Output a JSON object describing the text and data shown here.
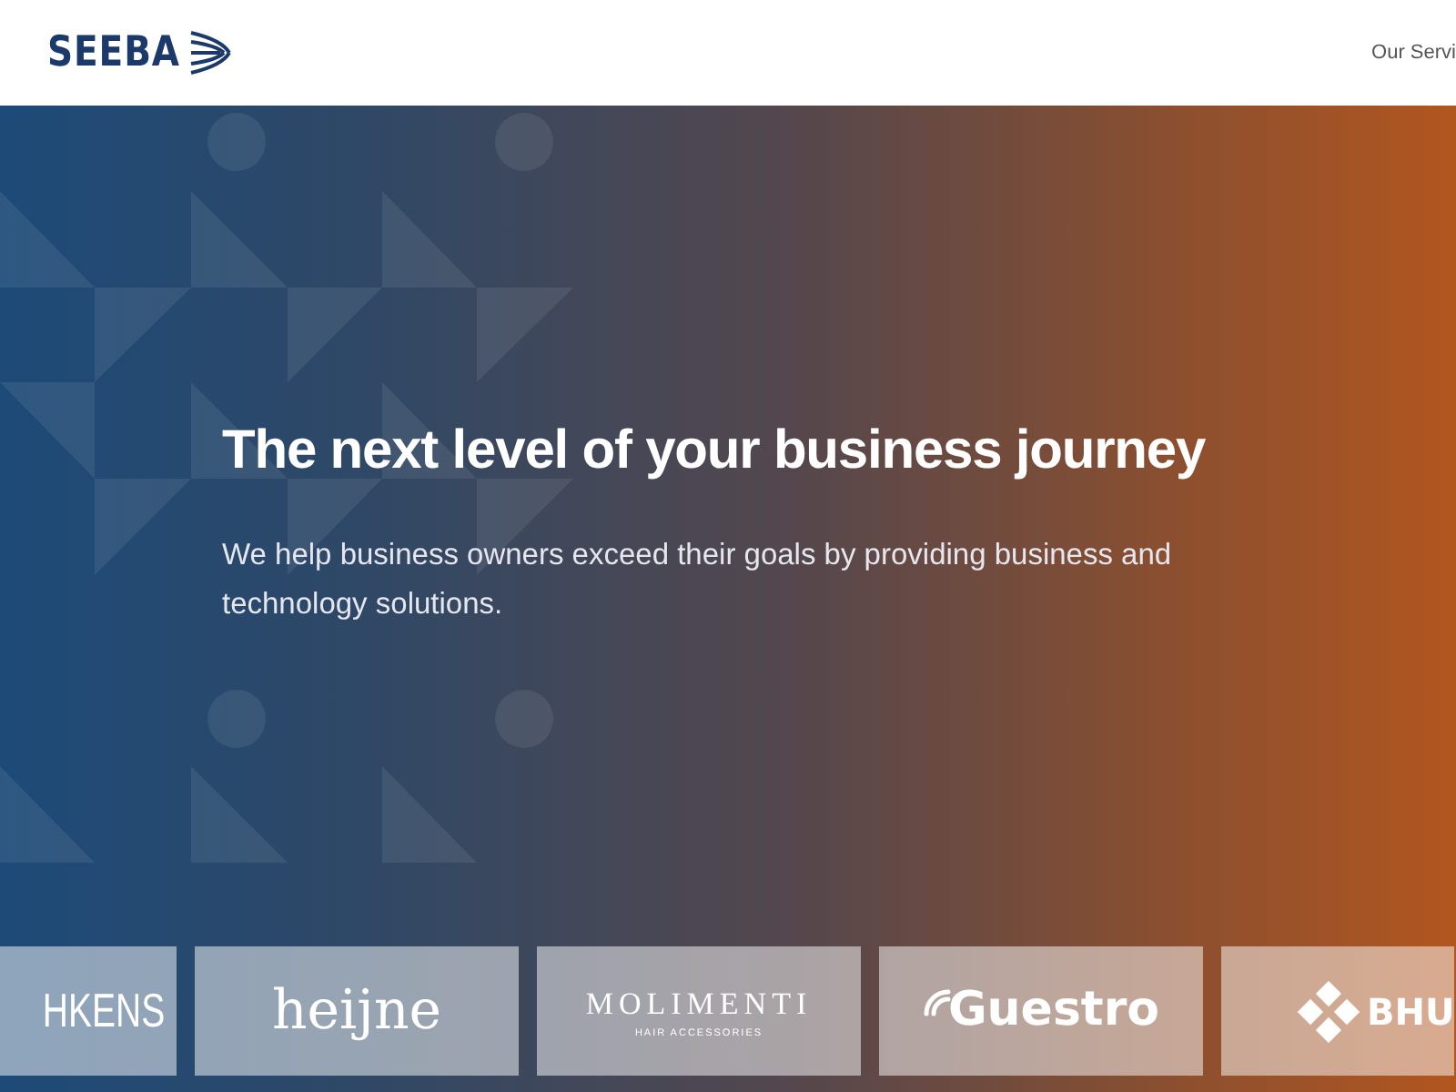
{
  "header": {
    "logo": "SEEBA",
    "nav": [
      "Our Servi"
    ]
  },
  "hero": {
    "title": "The next level of your business journey",
    "subtitle": "We help business owners exceed their goals by providing business and technology solutions."
  },
  "clients": [
    {
      "kind": "wordmark",
      "name": "HKENS"
    },
    {
      "kind": "script",
      "name": "heijne"
    },
    {
      "kind": "stacked",
      "name": "MOLIMENTI",
      "tagline": "HAIR ACCESSORIES"
    },
    {
      "kind": "signal",
      "name": "Guestro"
    },
    {
      "kind": "emblem",
      "name": "BHU"
    }
  ]
}
